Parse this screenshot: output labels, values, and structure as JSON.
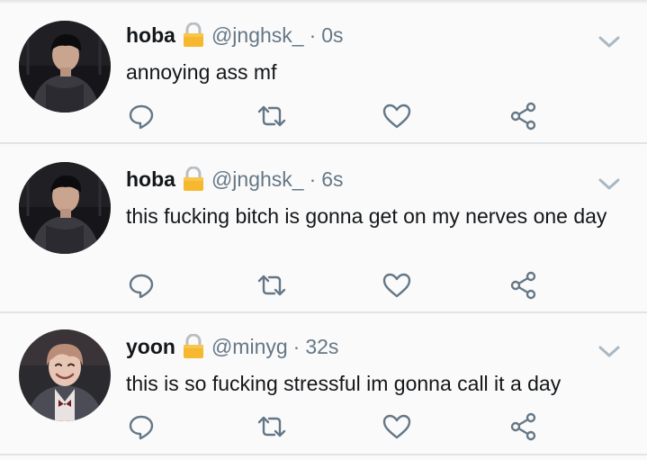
{
  "colors": {
    "text": "#14171a",
    "secondary": "#657786",
    "icon": "#657786",
    "divider": "#e1e4e6",
    "lock": "#f5b82e"
  },
  "tweets": [
    {
      "name": "hoba",
      "handle": "@jnghsk_",
      "separator": "·",
      "time": "0s",
      "text": "annoying ass mf",
      "avatar": "boy-dark-hoodie-avatar",
      "protected": true
    },
    {
      "name": "hoba",
      "handle": "@jnghsk_",
      "separator": "·",
      "time": "6s",
      "text": "this fucking bitch is gonna get on my nerves one day",
      "avatar": "boy-dark-hoodie-avatar",
      "protected": true
    },
    {
      "name": "yoon",
      "handle": "@minyg",
      "separator": "·",
      "time": "32s",
      "text": "this is so fucking stressful im gonna call it a day",
      "avatar": "smiling-boy-avatar",
      "protected": true
    }
  ],
  "actions": [
    "reply-icon",
    "retweet-icon",
    "like-icon",
    "share-icon"
  ]
}
